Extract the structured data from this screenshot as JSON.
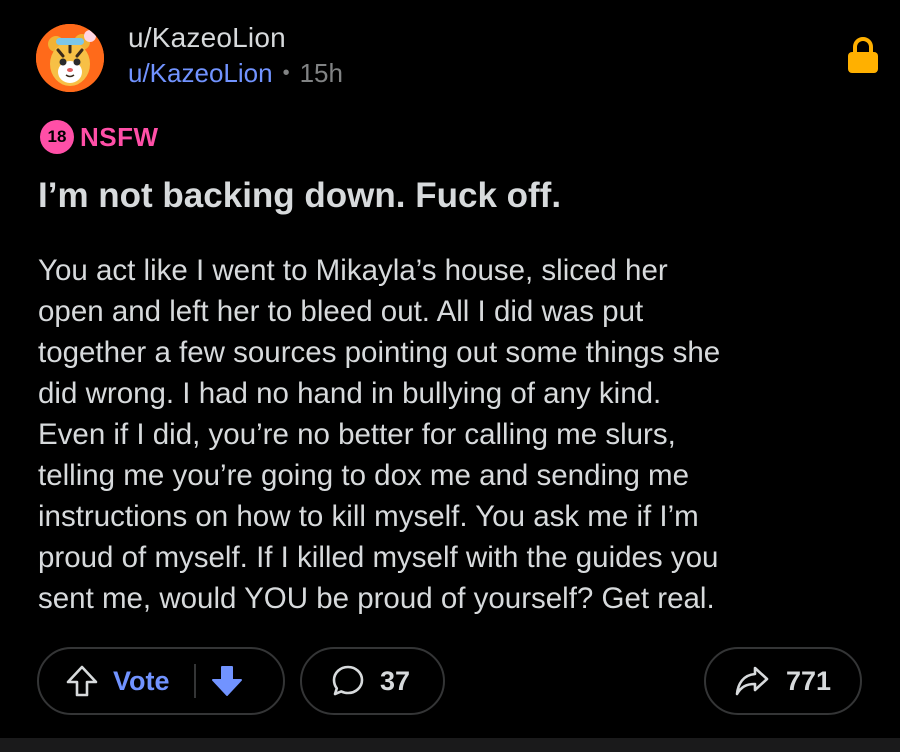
{
  "post": {
    "subreddit": "u/KazeoLion",
    "author": "u/KazeoLion",
    "separator": "•",
    "age": "15h",
    "nsfw": {
      "badge": "18",
      "label": "NSFW",
      "color": "#ff4fa7"
    },
    "title": "I’m not backing down. Fuck off.",
    "body_lines": [
      "You act like I went to Mikayla’s house, sliced her",
      "open and left her to bleed out. All I did was put",
      "together a few sources pointing out some things she",
      "did wrong. I had no hand in bullying of any kind.",
      "Even if I did, you’re no better for calling me slurs,",
      "telling me you’re going to dox me and sending me",
      "instructions on how to kill myself. You ask me if I’m",
      "proud of myself. If I killed myself with the guides you",
      "sent me, would YOU be proud of yourself? Get real."
    ]
  },
  "actions": {
    "vote_label": "Vote",
    "comment_count": "37",
    "share_count": "771",
    "icons": {
      "upvote": "arrow-up-outline-icon",
      "downvote": "arrow-down-filled-icon",
      "comment": "speech-bubble-icon",
      "share": "share-arrow-icon",
      "lock": "lock-icon"
    }
  },
  "colors": {
    "background": "#000000",
    "text": "#d7dadc",
    "link": "#7193ff",
    "muted": "#818384",
    "lock": "#ffb000",
    "avatar_bg": "#ff6a1a"
  }
}
